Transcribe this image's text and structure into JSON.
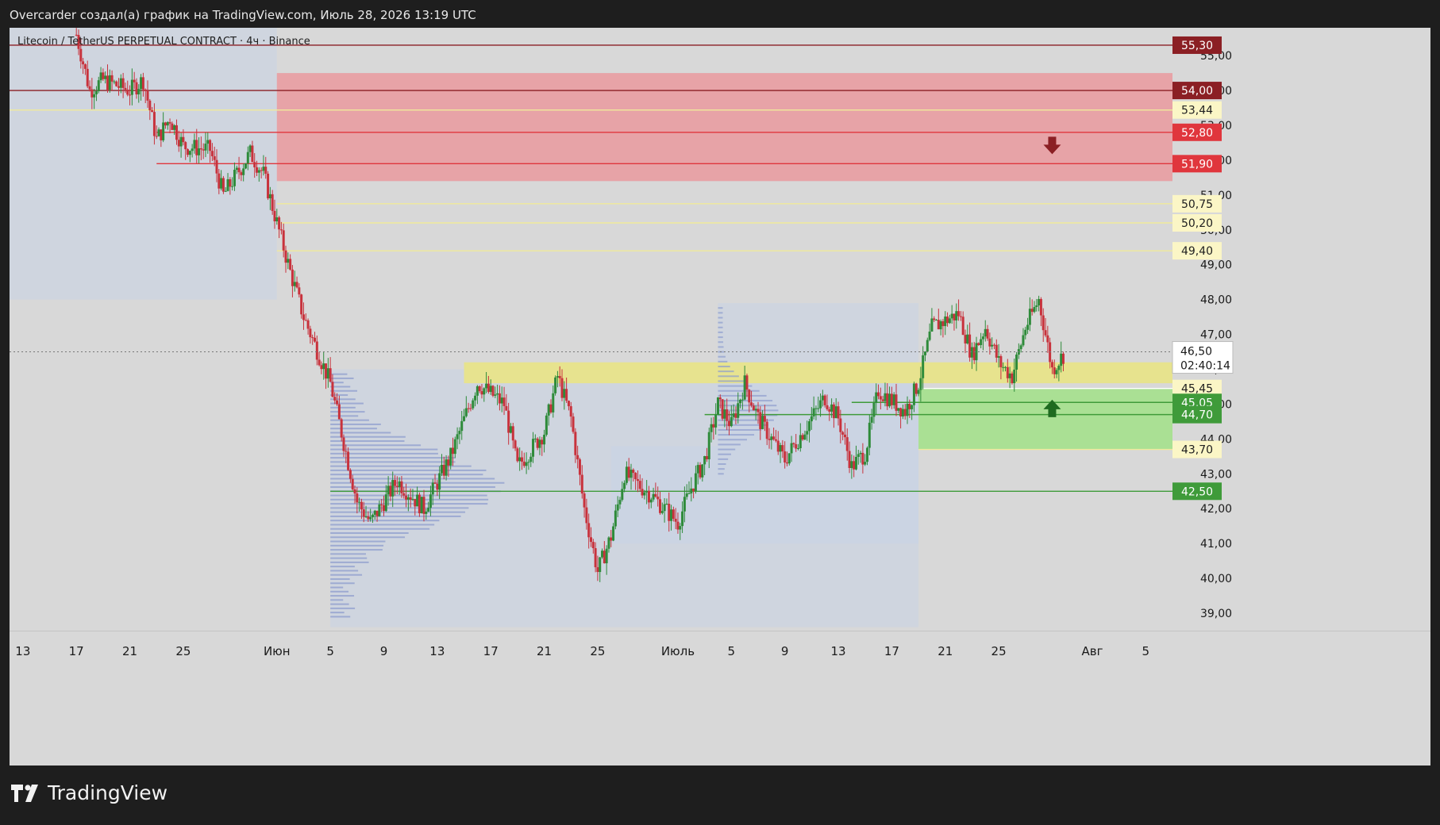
{
  "caption": "Overcarder создал(а) график на TradingView.com, Июль 28, 2026 13:19 UTC",
  "symbol": "Litecoin / TetherUS PERPETUAL CONTRACT · 4ч · Binance",
  "brand": "TradingView",
  "chart_data": {
    "type": "candlestick",
    "y_ticks": [
      "39,00",
      "40,00",
      "41,00",
      "42,00",
      "43,00",
      "44,00",
      "45,00",
      "46,00",
      "47,00",
      "48,00",
      "49,00",
      "50,00",
      "51,00",
      "52,00",
      "53,00",
      "54,00",
      "55,00"
    ],
    "y_range": [
      38.5,
      55.8
    ],
    "x_ticks": [
      {
        "label": "13",
        "date": "2026-05-13"
      },
      {
        "label": "17",
        "date": "2026-05-17"
      },
      {
        "label": "21",
        "date": "2026-05-21"
      },
      {
        "label": "25",
        "date": "2026-05-25"
      },
      {
        "label": "Июн",
        "date": "2026-06-01"
      },
      {
        "label": "5",
        "date": "2026-06-05"
      },
      {
        "label": "9",
        "date": "2026-06-09"
      },
      {
        "label": "13",
        "date": "2026-06-13"
      },
      {
        "label": "17",
        "date": "2026-06-17"
      },
      {
        "label": "21",
        "date": "2026-06-21"
      },
      {
        "label": "25",
        "date": "2026-06-25"
      },
      {
        "label": "Июль",
        "date": "2026-07-01"
      },
      {
        "label": "5",
        "date": "2026-07-05"
      },
      {
        "label": "9",
        "date": "2026-07-09"
      },
      {
        "label": "13",
        "date": "2026-07-13"
      },
      {
        "label": "17",
        "date": "2026-07-17"
      },
      {
        "label": "21",
        "date": "2026-07-21"
      },
      {
        "label": "25",
        "date": "2026-07-25"
      },
      {
        "label": "Авг",
        "date": "2026-08-01"
      },
      {
        "label": "5",
        "date": "2026-08-05"
      }
    ],
    "x_range": [
      "2026-05-12",
      "2026-08-07"
    ],
    "price_path": [
      {
        "date": "2026-05-17",
        "price": 55.6
      },
      {
        "date": "2026-05-18",
        "price": 54.0
      },
      {
        "date": "2026-05-19",
        "price": 54.3
      },
      {
        "date": "2026-05-21",
        "price": 54.0
      },
      {
        "date": "2026-05-22",
        "price": 54.3
      },
      {
        "date": "2026-05-23",
        "price": 52.6
      },
      {
        "date": "2026-05-24",
        "price": 53.2
      },
      {
        "date": "2026-05-25",
        "price": 52.4
      },
      {
        "date": "2026-05-27",
        "price": 52.3
      },
      {
        "date": "2026-05-28",
        "price": 51.0
      },
      {
        "date": "2026-05-30",
        "price": 52.2
      },
      {
        "date": "2026-05-31",
        "price": 51.6
      },
      {
        "date": "2026-06-01",
        "price": 50.2
      },
      {
        "date": "2026-06-02",
        "price": 48.8
      },
      {
        "date": "2026-06-03",
        "price": 47.5
      },
      {
        "date": "2026-06-05",
        "price": 45.6
      },
      {
        "date": "2026-06-07",
        "price": 42.2
      },
      {
        "date": "2026-06-08",
        "price": 41.6
      },
      {
        "date": "2026-06-10",
        "price": 42.8
      },
      {
        "date": "2026-06-12",
        "price": 42.0
      },
      {
        "date": "2026-06-14",
        "price": 43.5
      },
      {
        "date": "2026-06-16",
        "price": 45.6
      },
      {
        "date": "2026-06-18",
        "price": 45.0
      },
      {
        "date": "2026-06-19",
        "price": 43.2
      },
      {
        "date": "2026-06-21",
        "price": 44.2
      },
      {
        "date": "2026-06-22",
        "price": 45.8
      },
      {
        "date": "2026-06-23",
        "price": 44.6
      },
      {
        "date": "2026-06-24",
        "price": 42.0
      },
      {
        "date": "2026-06-25",
        "price": 40.2
      },
      {
        "date": "2026-06-26",
        "price": 41.2
      },
      {
        "date": "2026-06-27",
        "price": 43.0
      },
      {
        "date": "2026-06-29",
        "price": 42.4
      },
      {
        "date": "2026-06-30",
        "price": 42.0
      },
      {
        "date": "2026-07-01",
        "price": 41.6
      },
      {
        "date": "2026-07-02",
        "price": 42.6
      },
      {
        "date": "2026-07-03",
        "price": 43.4
      },
      {
        "date": "2026-07-04",
        "price": 45.0
      },
      {
        "date": "2026-07-05",
        "price": 44.4
      },
      {
        "date": "2026-07-06",
        "price": 45.6
      },
      {
        "date": "2026-07-07",
        "price": 44.6
      },
      {
        "date": "2026-07-09",
        "price": 43.4
      },
      {
        "date": "2026-07-10",
        "price": 44.0
      },
      {
        "date": "2026-07-11",
        "price": 44.6
      },
      {
        "date": "2026-07-12",
        "price": 45.2
      },
      {
        "date": "2026-07-13",
        "price": 44.6
      },
      {
        "date": "2026-07-14",
        "price": 43.2
      },
      {
        "date": "2026-07-15",
        "price": 43.6
      },
      {
        "date": "2026-07-16",
        "price": 45.4
      },
      {
        "date": "2026-07-18",
        "price": 44.8
      },
      {
        "date": "2026-07-19",
        "price": 45.6
      },
      {
        "date": "2026-07-20",
        "price": 47.2
      },
      {
        "date": "2026-07-22",
        "price": 47.6
      },
      {
        "date": "2026-07-23",
        "price": 46.4
      },
      {
        "date": "2026-07-24",
        "price": 47.2
      },
      {
        "date": "2026-07-25",
        "price": 46.2
      },
      {
        "date": "2026-07-26",
        "price": 45.8
      },
      {
        "date": "2026-07-27",
        "price": 47.2
      },
      {
        "date": "2026-07-28",
        "price": 48.0
      },
      {
        "date": "2026-07-29",
        "price": 46.0
      },
      {
        "date": "2026-07-30",
        "price": 46.5
      }
    ],
    "zones": [
      {
        "kind": "sell",
        "from": "2026-06-01",
        "to": "2026-08-07",
        "low": 51.4,
        "high": 54.5,
        "color": "#e8a0a4"
      },
      {
        "kind": "level",
        "from": "2026-06-15",
        "to": "2026-08-07",
        "low": 45.6,
        "high": 46.2,
        "color": "#e8e48a"
      },
      {
        "kind": "buy",
        "from": "2026-07-19",
        "to": "2026-08-07",
        "low": 43.7,
        "high": 45.45,
        "color": "#a8e090"
      }
    ],
    "lines": [
      {
        "price": 55.3,
        "color": "#8b1f24",
        "from": "2026-05-12"
      },
      {
        "price": 54.0,
        "color": "#8b1f24",
        "from": "2026-05-12"
      },
      {
        "price": 53.44,
        "color": "#f0ea9a",
        "from": "2026-05-12"
      },
      {
        "price": 52.8,
        "color": "#e0363d",
        "from": "2026-05-23"
      },
      {
        "price": 51.9,
        "color": "#e0363d",
        "from": "2026-05-23"
      },
      {
        "price": 50.75,
        "color": "#f0ea9a",
        "from": "2026-06-01"
      },
      {
        "price": 50.2,
        "color": "#f0ea9a",
        "from": "2026-06-01"
      },
      {
        "price": 49.4,
        "color": "#f0ea9a",
        "from": "2026-06-01"
      },
      {
        "price": 45.45,
        "color": "#ffffff",
        "from": "2026-07-19"
      },
      {
        "price": 45.05,
        "color": "#3f9b3a",
        "from": "2026-07-14"
      },
      {
        "price": 44.7,
        "color": "#3f9b3a",
        "from": "2026-07-03"
      },
      {
        "price": 43.7,
        "color": "#f0ea9a",
        "from": "2026-07-19"
      },
      {
        "price": 42.5,
        "color": "#3f9b3a",
        "from": "2026-06-05"
      }
    ],
    "price_tags": [
      {
        "price": 55.3,
        "label": "55,30",
        "bg": "#8b1f24",
        "fg": "#ffffff"
      },
      {
        "price": 54.0,
        "label": "54,00",
        "bg": "#8b1f24",
        "fg": "#ffffff"
      },
      {
        "price": 53.44,
        "label": "53,44",
        "bg": "#fbf6c6",
        "fg": "#202020"
      },
      {
        "price": 52.8,
        "label": "52,80",
        "bg": "#e0363d",
        "fg": "#ffffff"
      },
      {
        "price": 51.9,
        "label": "51,90",
        "bg": "#e0363d",
        "fg": "#ffffff"
      },
      {
        "price": 50.75,
        "label": "50,75",
        "bg": "#fbf6c6",
        "fg": "#202020"
      },
      {
        "price": 50.2,
        "label": "50,20",
        "bg": "#fbf6c6",
        "fg": "#202020"
      },
      {
        "price": 49.4,
        "label": "49,40",
        "bg": "#fbf6c6",
        "fg": "#202020"
      },
      {
        "price": 45.45,
        "label": "45,45",
        "bg": "#fbf6c6",
        "fg": "#202020"
      },
      {
        "price": 45.05,
        "label": "45,05",
        "bg": "#3f9b3a",
        "fg": "#ffffff"
      },
      {
        "price": 44.7,
        "label": "44,70",
        "bg": "#3f9b3a",
        "fg": "#ffffff"
      },
      {
        "price": 43.7,
        "label": "43,70",
        "bg": "#fbf6c6",
        "fg": "#202020"
      },
      {
        "price": 42.5,
        "label": "42,50",
        "bg": "#3f9b3a",
        "fg": "#ffffff"
      }
    ],
    "current_price": {
      "price": 46.5,
      "label": "46,50",
      "countdown": "02:40:14"
    },
    "arrows": [
      {
        "direction": "down",
        "date": "2026-07-29",
        "price": 52.4,
        "color": "#8b1f24"
      },
      {
        "direction": "up",
        "date": "2026-07-29",
        "price": 44.9,
        "color": "#1f6b20"
      }
    ],
    "colors": {
      "up": "#2e8b3a",
      "down": "#c8323c",
      "background": "#d8d8d8",
      "volume_profile": "#8d9ccd"
    },
    "grid": false
  }
}
